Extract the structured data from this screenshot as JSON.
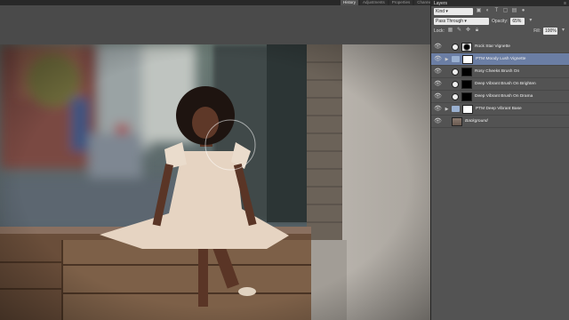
{
  "top_tabs": [
    "History",
    "Adjustments",
    "Properties",
    "Channels"
  ],
  "top_icon": "close-x-icon",
  "layers_panel": {
    "title": "Layers",
    "menu_icon": "panel-menu-icon",
    "filter_kind": "Kind",
    "blend_mode": "Pass Through",
    "opacity_label": "Opacity:",
    "opacity_value": "65%",
    "lock_label": "Lock:",
    "fill_label": "Fill:",
    "fill_value": "100%",
    "layers": [
      {
        "name": "Rock Star Vignette",
        "visible": true,
        "type": "adjustment",
        "thumb": "vignette",
        "selected": false
      },
      {
        "name": "PTM Moody Lush Vignette",
        "visible": true,
        "type": "group",
        "thumb": "white",
        "selected": true
      },
      {
        "name": "Rosy Cheeks Brush On",
        "visible": true,
        "type": "adjustment",
        "thumb": "black",
        "selected": false
      },
      {
        "name": "Deep Vibrant Brush On Brighten",
        "visible": true,
        "type": "adjustment",
        "thumb": "black",
        "selected": false
      },
      {
        "name": "Deep Vibrant Brush On Drama",
        "visible": true,
        "type": "adjustment",
        "thumb": "black",
        "selected": false
      },
      {
        "name": "PTM Deep Vibrant Base",
        "visible": true,
        "type": "group",
        "thumb": "white",
        "selected": false
      },
      {
        "name": "Background",
        "visible": true,
        "type": "pixel",
        "thumb": "photo",
        "selected": false
      }
    ]
  },
  "colors": {
    "selected_layer": "#6b7ea4",
    "panel_bg": "#535353"
  }
}
